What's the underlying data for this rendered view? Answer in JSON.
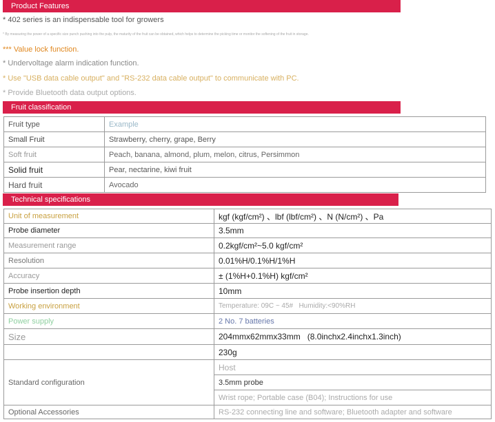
{
  "features": {
    "header": "Product Features",
    "intro": "* 402 series is an indispensable tool for growers",
    "small_note": "* By measuring the power of a specific size punch pushing into the pulp, the maturity of the fruit can be obtained, which helps to determine the picking time or monitor the softening of the fruit in storage.",
    "items": [
      "*** Value lock function.",
      "* Undervoltage alarm indication function.",
      "* Use \"USB data cable output\" and \"RS-232 data cable output\" to communicate with PC.",
      "* Provide Bluetooth data output options."
    ]
  },
  "fruit": {
    "header": "Fruit classification",
    "rows": [
      {
        "type": "Fruit type",
        "example": "Example"
      },
      {
        "type": "Small Fruit",
        "example": "Strawberry, cherry, grape, Berry"
      },
      {
        "type": "Soft fruit",
        "example": "Peach, banana, almond, plum, melon, citrus, Persimmon"
      },
      {
        "type": "Solid fruit",
        "example": "Pear, nectarine, kiwi fruit"
      },
      {
        "type": "Hard fruit",
        "example": "Avocado"
      }
    ]
  },
  "specs": {
    "header": "Technical specifications",
    "rows": [
      {
        "label": "Unit of measurement",
        "value": "kgf (kgf/cm²) 、lbf (lbf/cm²) 、N (N/cm²) 、Pa"
      },
      {
        "label": "Probe diameter",
        "value": "3.5mm"
      },
      {
        "label": "Measurement range",
        "value": "0.2kgf/cm²~5.0 kgf/cm²"
      },
      {
        "label": "Resolution",
        "value": "0.01%H/0.1%H/1%H"
      },
      {
        "label": "Accuracy",
        "value": "± (1%H+0.1%H) kgf/cm²"
      },
      {
        "label": "Probe insertion depth",
        "value": "10mm"
      },
      {
        "label": "Working environment",
        "value": "Temperature: 09C ~ 45#   Humidity:<90%RH"
      },
      {
        "label": "Power supply",
        "value": "2 No. 7 batteries"
      },
      {
        "label": "Size",
        "value": "204mmx62mmx33mm   (8.0inchx2.4inchx1.3inch)"
      },
      {
        "label": "",
        "value": "230g"
      }
    ],
    "standard_label": "Standard configuration",
    "standard_items": [
      "Host",
      "3.5mm probe",
      "Wrist rope; Portable case (B04); Instructions for use"
    ],
    "optional_label": "Optional Accessories",
    "optional_value": "RS-232 connecting line and software; Bluetooth adapter and software"
  },
  "colors": {
    "accent": "#d9204a",
    "gold": "#c8a040",
    "orange": "#e08820",
    "green": "#8fd0a0"
  }
}
